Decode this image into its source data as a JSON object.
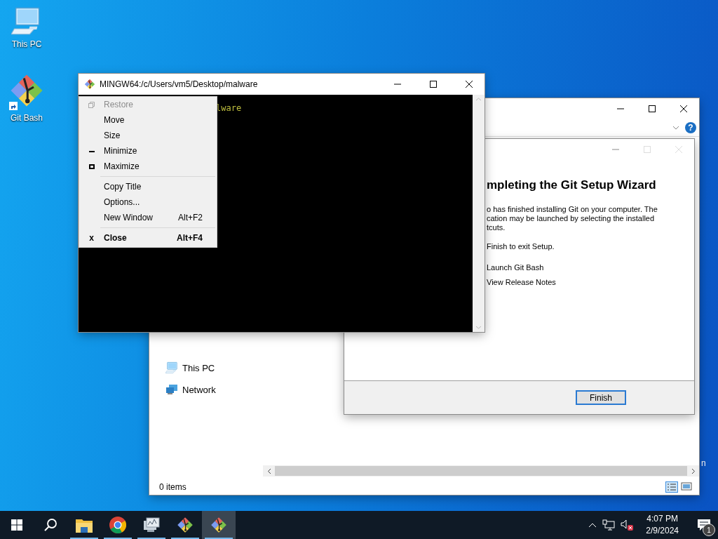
{
  "desktop": {
    "icons": [
      {
        "label": "This PC",
        "kind": "computer"
      },
      {
        "label": "Git Bash",
        "kind": "git"
      }
    ],
    "edge_text": "n"
  },
  "explorer": {
    "help": "?",
    "nav_items": [
      {
        "label": "This PC",
        "kind": "computer"
      },
      {
        "label": "Network",
        "kind": "network"
      }
    ],
    "status": "0 items"
  },
  "wizard": {
    "heading": "mpleting the Git Setup Wizard",
    "body_lines": [
      "o has finished installing Git on your computer. The",
      "cation may be launched by selecting the installed",
      "tcuts."
    ],
    "finish_note": "Finish to exit Setup.",
    "options": [
      "Launch Git Bash",
      "View Release Notes"
    ],
    "button": "Finish"
  },
  "terminal": {
    "title": "MINGW64:/c/Users/vm5/Desktop/malware",
    "output": "lware",
    "menu": [
      {
        "label": "Restore",
        "kind": "restore",
        "disabled": true
      },
      {
        "label": "Move",
        "disabled": false
      },
      {
        "label": "Size",
        "disabled": false
      },
      {
        "label": "Minimize",
        "kind": "minimize",
        "disabled": false
      },
      {
        "label": "Maximize",
        "kind": "maximize",
        "disabled": false,
        "separator_after": true
      },
      {
        "label": "Copy Title",
        "disabled": false
      },
      {
        "label": "Options...",
        "disabled": false
      },
      {
        "label": "New Window",
        "shortcut": "Alt+F2",
        "disabled": false,
        "separator_after": true
      },
      {
        "label": "Close",
        "glyph": "x",
        "shortcut": "Alt+F4",
        "bold": true,
        "disabled": false
      }
    ]
  },
  "taskbar": {
    "apps": [
      {
        "kind": "explorer",
        "running": true,
        "selected": false
      },
      {
        "kind": "chrome",
        "running": true,
        "selected": false
      },
      {
        "kind": "monitor",
        "running": true,
        "selected": false
      },
      {
        "kind": "git",
        "running": true,
        "selected": false
      },
      {
        "kind": "git",
        "running": true,
        "selected": true
      }
    ],
    "time": "4:07 PM",
    "date": "2/9/2024",
    "notifications": "1"
  }
}
